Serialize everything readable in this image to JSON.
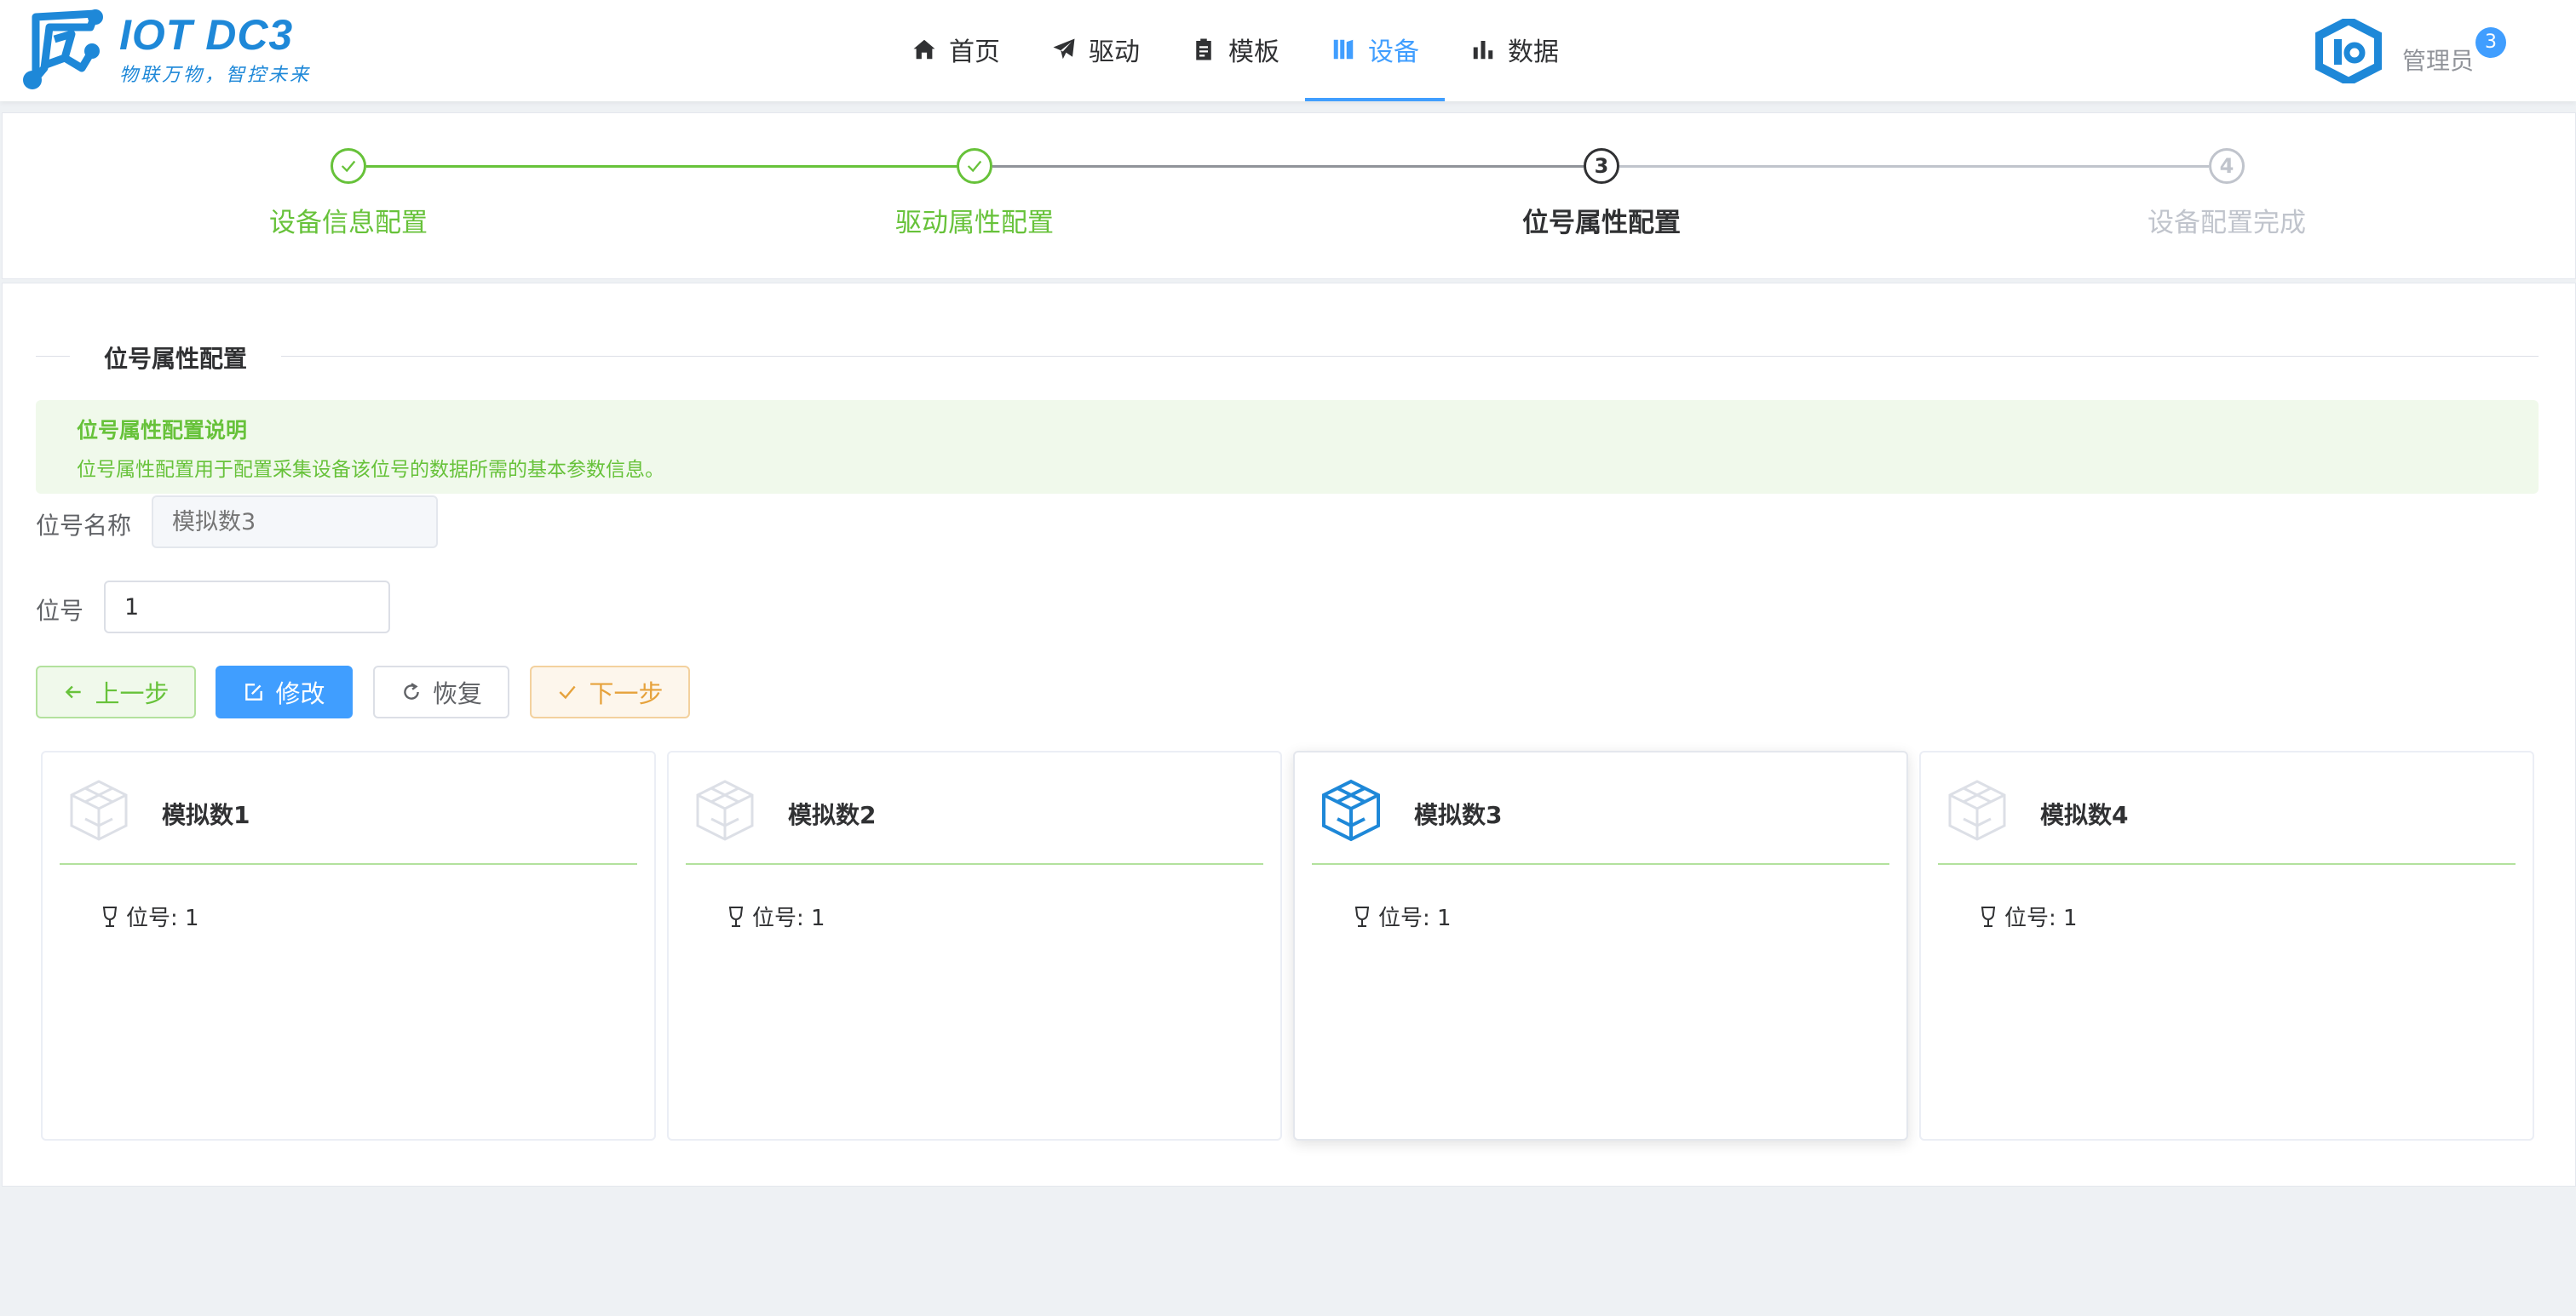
{
  "header": {
    "brand_title": "IOT DC3",
    "brand_subtitle": "物联万物，智控未来",
    "nav": [
      {
        "label": "首页",
        "icon": "home-icon"
      },
      {
        "label": "驱动",
        "icon": "paper-plane-icon"
      },
      {
        "label": "模板",
        "icon": "clipboard-icon"
      },
      {
        "label": "设备",
        "icon": "device-book-icon",
        "active": true
      },
      {
        "label": "数据",
        "icon": "bar-chart-icon"
      }
    ],
    "user_name": "管理员",
    "notification_count": "3",
    "accent_color": "#409eff"
  },
  "steps": [
    {
      "index": "1",
      "title": "设备信息配置",
      "status": "finished"
    },
    {
      "index": "2",
      "title": "驱动属性配置",
      "status": "finished"
    },
    {
      "index": "3",
      "title": "位号属性配置",
      "status": "process"
    },
    {
      "index": "4",
      "title": "设备配置完成",
      "status": "wait"
    }
  ],
  "section": {
    "divider_title": "位号属性配置",
    "alert_title": "位号属性配置说明",
    "alert_desc": "位号属性配置用于配置采集设备该位号的数据所需的基本参数信息。"
  },
  "form": {
    "point_name_label": "位号名称",
    "point_name_placeholder": "模拟数3",
    "point_label": "位号",
    "point_value": "1"
  },
  "buttons": {
    "prev": "上一步",
    "edit": "修改",
    "reset": "恢复",
    "next": "下一步"
  },
  "point_cards": [
    {
      "title": "模拟数1",
      "field": "位号: 1",
      "selected": false
    },
    {
      "title": "模拟数2",
      "field": "位号: 1",
      "selected": false
    },
    {
      "title": "模拟数3",
      "field": "位号: 1",
      "selected": true
    },
    {
      "title": "模拟数4",
      "field": "位号: 1",
      "selected": false
    }
  ],
  "colors": {
    "success": "#67c23a",
    "primary": "#409eff",
    "warning": "#e6a23c",
    "muted": "#c0c4cc"
  }
}
